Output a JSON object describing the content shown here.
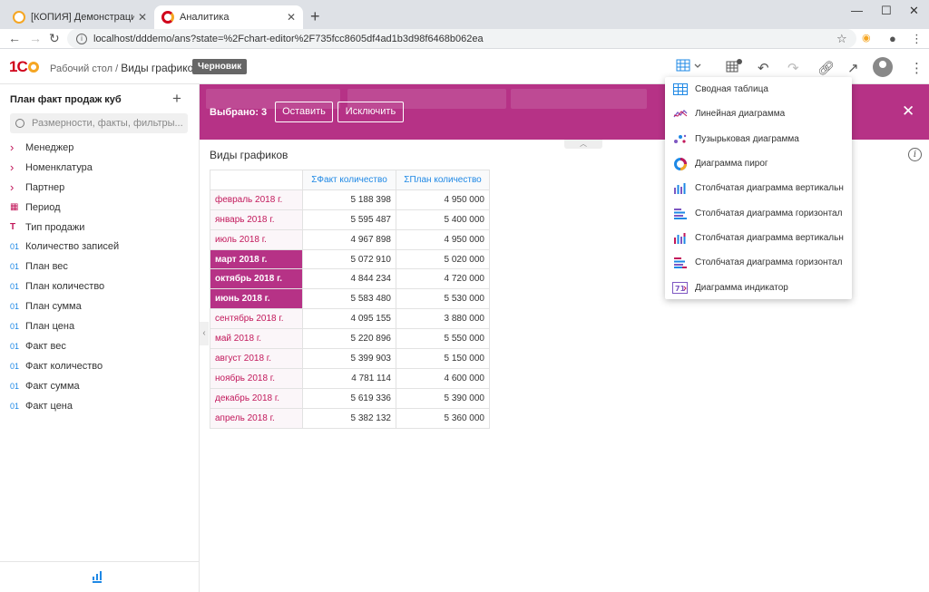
{
  "browser": {
    "tabs": [
      {
        "title": "[КОПИЯ] Демонстрационная ба",
        "active": false
      },
      {
        "title": "Аналитика",
        "active": true
      }
    ],
    "url": "localhost/dddemo/ans?state=%2Fchart-editor%2F735fcc8605df4ad1b3d98f6468b062ea"
  },
  "header": {
    "logo": "1С",
    "breadcrumb_root": "Рабочий стол /",
    "breadcrumb_current": "Виды графиков",
    "badge": "Черновик"
  },
  "left_panel": {
    "title": "План факт продаж куб",
    "search_placeholder": "Размерности, факты, фильтры...",
    "items": [
      {
        "label": "Менеджер",
        "icon": "chevron-right-icon",
        "kind": "dim"
      },
      {
        "label": "Номенклатура",
        "icon": "chevron-right-icon",
        "kind": "dim"
      },
      {
        "label": "Партнер",
        "icon": "chevron-right-icon",
        "kind": "dim"
      },
      {
        "label": "Период",
        "icon": "calendar-icon",
        "kind": "date"
      },
      {
        "label": "Тип продажи",
        "icon": "text-icon",
        "kind": "txt"
      },
      {
        "label": "Количество записей",
        "icon": "number-icon",
        "kind": "num"
      },
      {
        "label": "План вес",
        "icon": "number-icon",
        "kind": "num"
      },
      {
        "label": "План количество",
        "icon": "number-icon",
        "kind": "num"
      },
      {
        "label": "План сумма",
        "icon": "number-icon",
        "kind": "num"
      },
      {
        "label": "План цена",
        "icon": "number-icon",
        "kind": "num"
      },
      {
        "label": "Факт вес",
        "icon": "number-icon",
        "kind": "num"
      },
      {
        "label": "Факт количество",
        "icon": "number-icon",
        "kind": "num"
      },
      {
        "label": "Факт сумма",
        "icon": "number-icon",
        "kind": "num"
      },
      {
        "label": "Факт цена",
        "icon": "number-icon",
        "kind": "num"
      }
    ]
  },
  "selection_bar": {
    "label": "Выбрано: 3",
    "keep_button": "Оставить",
    "exclude_button": "Исключить",
    "color": "#b63286"
  },
  "main": {
    "title": "Виды графиков",
    "table": {
      "columns": [
        "ΣФакт количество",
        "ΣПлан количество"
      ],
      "rows": [
        {
          "label": "февраль 2018 г.",
          "fact": "5 188 398",
          "plan": "4 950 000",
          "selected": false
        },
        {
          "label": "январь 2018 г.",
          "fact": "5 595 487",
          "plan": "5 400 000",
          "selected": false
        },
        {
          "label": "июль 2018 г.",
          "fact": "4 967 898",
          "plan": "4 950 000",
          "selected": false
        },
        {
          "label": "март 2018 г.",
          "fact": "5 072 910",
          "plan": "5 020 000",
          "selected": true
        },
        {
          "label": "октябрь 2018 г.",
          "fact": "4 844 234",
          "plan": "4 720 000",
          "selected": true
        },
        {
          "label": "июнь 2018 г.",
          "fact": "5 583 480",
          "plan": "5 530 000",
          "selected": true
        },
        {
          "label": "сентябрь 2018 г.",
          "fact": "4 095 155",
          "plan": "3 880 000",
          "selected": false
        },
        {
          "label": "май 2018 г.",
          "fact": "5 220 896",
          "plan": "5 550 000",
          "selected": false
        },
        {
          "label": "август 2018 г.",
          "fact": "5 399 903",
          "plan": "5 150 000",
          "selected": false
        },
        {
          "label": "ноябрь 2018 г.",
          "fact": "4 781 114",
          "plan": "4 600 000",
          "selected": false
        },
        {
          "label": "декабрь 2018 г.",
          "fact": "5 619 336",
          "plan": "5 390 000",
          "selected": false
        },
        {
          "label": "апрель 2018 г.",
          "fact": "5 382 132",
          "plan": "5 360 000",
          "selected": false
        }
      ]
    }
  },
  "chart_type_menu": {
    "items": [
      {
        "label": "Сводная таблица",
        "icon": "pivot-table-icon"
      },
      {
        "label": "Линейная диаграмма",
        "icon": "line-chart-icon"
      },
      {
        "label": "Пузырьковая диаграмма",
        "icon": "bubble-chart-icon"
      },
      {
        "label": "Диаграмма пирог",
        "icon": "pie-chart-icon"
      },
      {
        "label": "Столбчатая диаграмма вертикальн",
        "icon": "vertical-bar-chart-icon"
      },
      {
        "label": "Столбчатая диаграмма горизонтал",
        "icon": "horizontal-bar-chart-icon"
      },
      {
        "label": "Столбчатая диаграмма вертикальн",
        "icon": "stacked-vertical-bar-chart-icon"
      },
      {
        "label": "Столбчатая диаграмма горизонтал",
        "icon": "stacked-horizontal-bar-chart-icon"
      },
      {
        "label": "Диаграмма индикатор",
        "icon": "indicator-chart-icon"
      }
    ]
  },
  "colors": {
    "accent": "#b63286",
    "measure_header": "#1e88e5",
    "brand_red": "#d0021b",
    "brand_yellow": "#f5a623"
  }
}
